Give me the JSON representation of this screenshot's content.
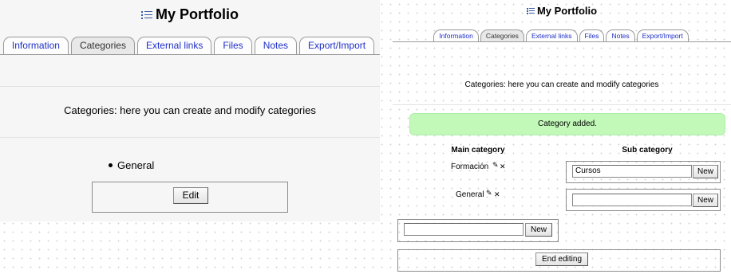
{
  "left": {
    "title": "My Portfolio",
    "tabs": [
      "Information",
      "Categories",
      "External links",
      "Files",
      "Notes",
      "Export/Import"
    ],
    "active_tab": "Categories",
    "description": "Categories: here you can create and modify categories",
    "categories": [
      "General"
    ],
    "edit_button": "Edit"
  },
  "right": {
    "title": "My Portfolio",
    "tabs": [
      "Information",
      "Categories",
      "External links",
      "Files",
      "Notes",
      "Export/Import"
    ],
    "active_tab": "Categories",
    "description": "Categories: here you can create and modify categories",
    "success_message": "Category added.",
    "headers": {
      "main": "Main category",
      "sub": "Sub category"
    },
    "categories": [
      {
        "name": "Formación",
        "sub_value": "Cursos",
        "new_button": "New"
      },
      {
        "name": "General",
        "sub_value": "",
        "new_button": "New"
      }
    ],
    "main_input": {
      "value": "",
      "new_button": "New"
    },
    "end_editing_button": "End editing"
  },
  "colors": {
    "tab_link": "#1f2fc9",
    "success_bg": "#c2f9b9",
    "page_panel": "#f6f6f6"
  },
  "icons": [
    "list-icon",
    "edit-icon",
    "delete-icon",
    "bullet-icon"
  ]
}
